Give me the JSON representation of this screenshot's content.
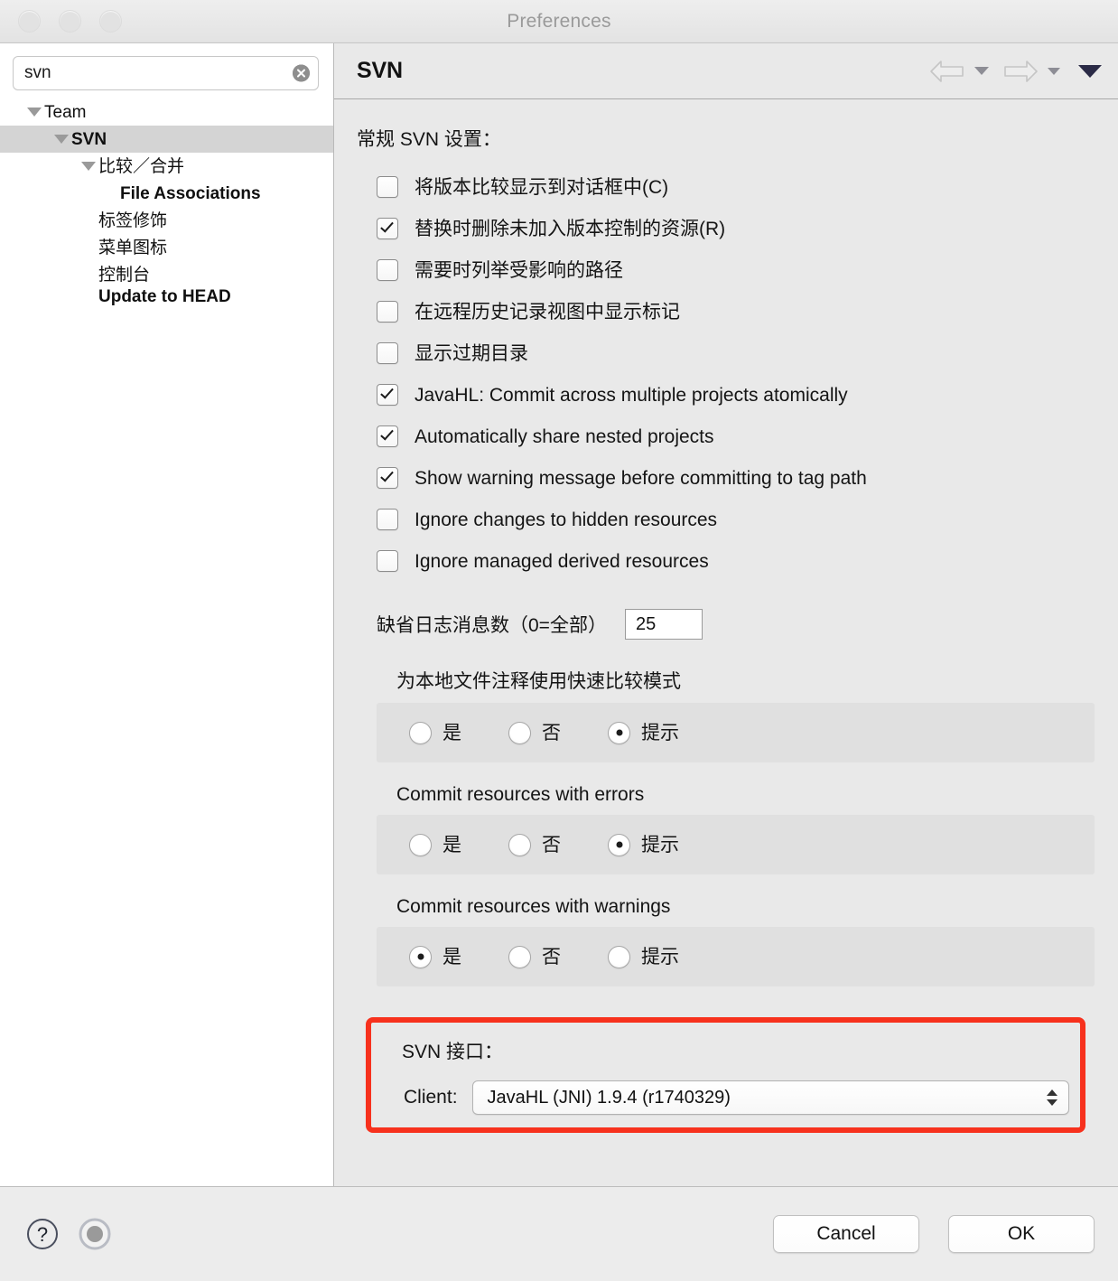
{
  "window": {
    "title": "Preferences",
    "traffic_lights": [
      "close",
      "minimize",
      "zoom"
    ]
  },
  "sidebar": {
    "search": {
      "value": "svn",
      "placeholder": "",
      "clear_glyph": "✕"
    },
    "tree": [
      {
        "label": "Team",
        "indent": 0,
        "twisty": true,
        "bold": false,
        "selected": false
      },
      {
        "label": "SVN",
        "indent": 1,
        "twisty": true,
        "bold": true,
        "selected": true
      },
      {
        "label": "比较／合并",
        "indent": 2,
        "twisty": true,
        "bold": false,
        "selected": false
      },
      {
        "label": "File Associations",
        "indent": 3,
        "twisty": false,
        "bold": true,
        "selected": false
      },
      {
        "label": "标签修饰",
        "indent": 2,
        "twisty": false,
        "bold": false,
        "selected": false
      },
      {
        "label": "菜单图标",
        "indent": 2,
        "twisty": false,
        "bold": false,
        "selected": false
      },
      {
        "label": "控制台",
        "indent": 2,
        "twisty": false,
        "bold": false,
        "selected": false
      },
      {
        "label": "Update to HEAD",
        "indent": 2,
        "twisty": false,
        "bold": true,
        "selected": false
      }
    ]
  },
  "content": {
    "header_title": "SVN",
    "nav": {
      "back_label": "back-arrow",
      "forward_label": "forward-arrow",
      "menu_label": "view-menu"
    },
    "general_settings_title": "常规 SVN 设置：",
    "checkboxes": [
      {
        "label": "将版本比较显示到对话框中(C)",
        "checked": false
      },
      {
        "label": "替换时删除未加入版本控制的资源(R)",
        "checked": true
      },
      {
        "label": "需要时列举受影响的路径",
        "checked": false
      },
      {
        "label": "在远程历史记录视图中显示标记",
        "checked": false
      },
      {
        "label": "显示过期目录",
        "checked": false
      },
      {
        "label": "JavaHL: Commit across multiple projects atomically",
        "checked": true
      },
      {
        "label": "Automatically share nested projects",
        "checked": true
      },
      {
        "label": "Show warning message before committing to tag path",
        "checked": true
      },
      {
        "label": "Ignore changes to hidden resources",
        "checked": false
      },
      {
        "label": "Ignore managed derived resources",
        "checked": false
      }
    ],
    "log_count": {
      "label": "缺省日志消息数（0=全部）",
      "value": "25"
    },
    "radio_groups": [
      {
        "title": "为本地文件注释使用快速比较模式",
        "options": [
          {
            "label": "是",
            "selected": false
          },
          {
            "label": "否",
            "selected": false
          },
          {
            "label": "提示",
            "selected": true
          }
        ]
      },
      {
        "title": "Commit resources with errors",
        "options": [
          {
            "label": "是",
            "selected": false
          },
          {
            "label": "否",
            "selected": false
          },
          {
            "label": "提示",
            "selected": true
          }
        ]
      },
      {
        "title": "Commit resources with warnings",
        "options": [
          {
            "label": "是",
            "selected": true
          },
          {
            "label": "否",
            "selected": false
          },
          {
            "label": "提示",
            "selected": false
          }
        ]
      }
    ],
    "svn_interface": {
      "title": "SVN 接口：",
      "client_label": "Client:",
      "client_value": "JavaHL (JNI) 1.9.4 (r1740329)",
      "highlight_color": "#f7311d"
    }
  },
  "footer": {
    "help_glyph": "?",
    "record_label": "record-button",
    "cancel_label": "Cancel",
    "ok_label": "OK"
  }
}
